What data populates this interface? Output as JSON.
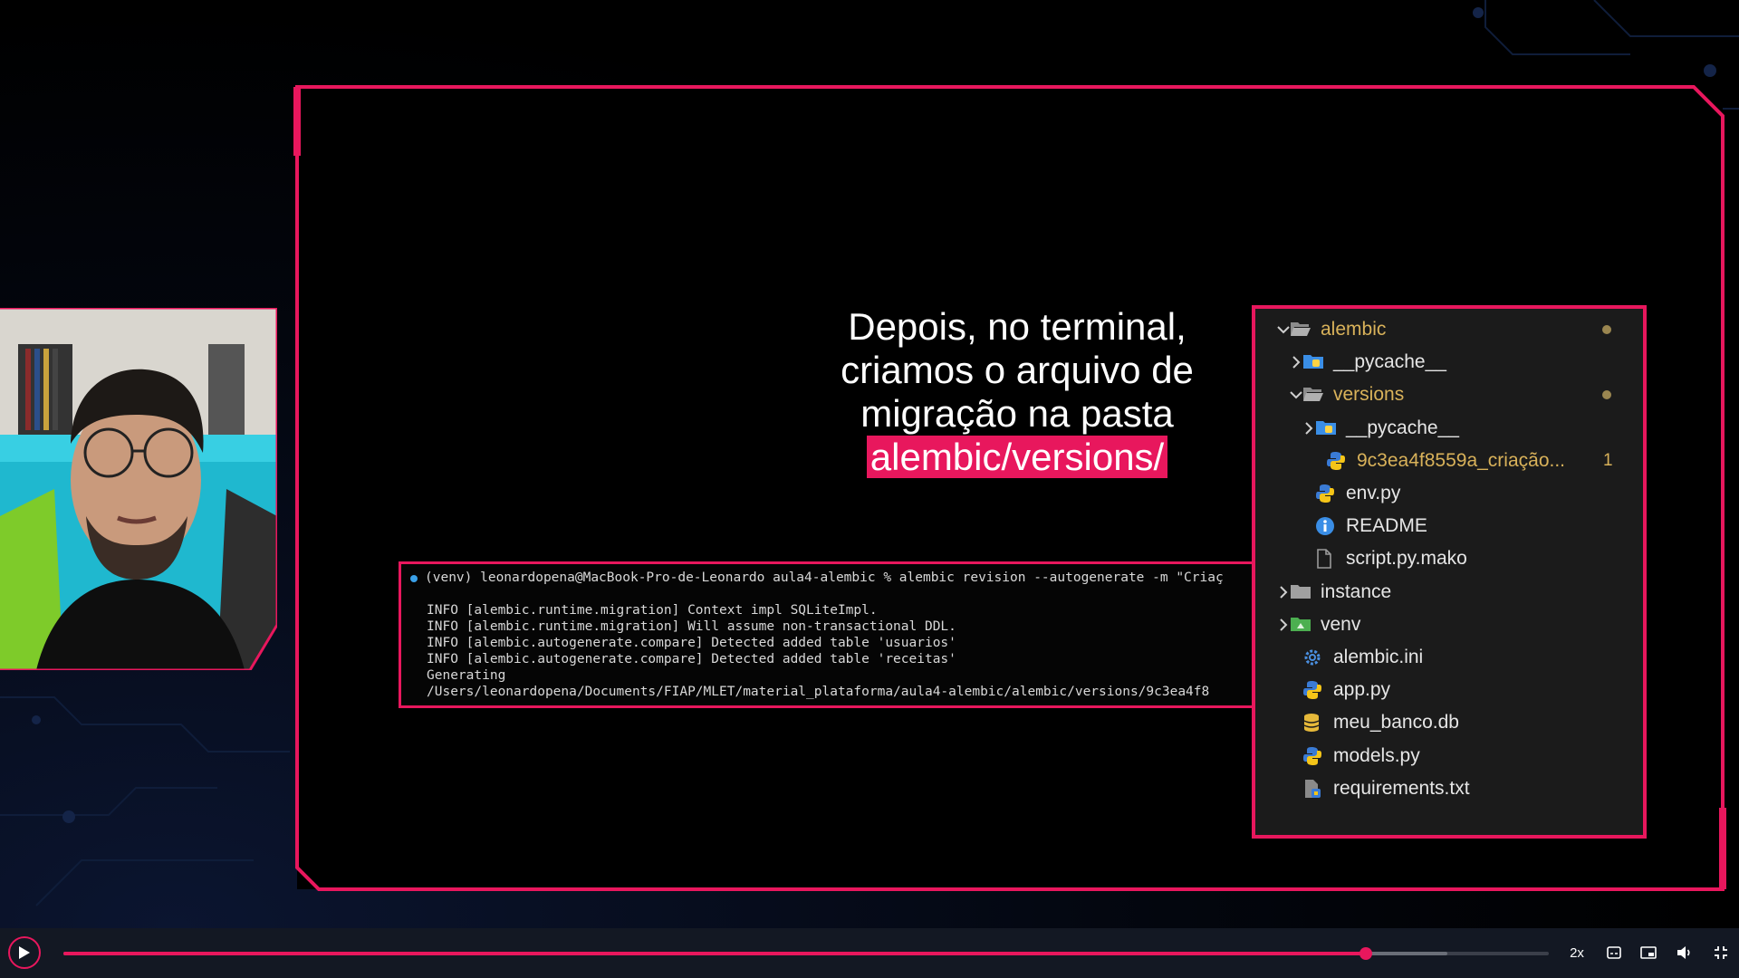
{
  "slide": {
    "headline_lines": [
      "Depois, no terminal,",
      "criamos o arquivo de",
      "migração na pasta"
    ],
    "headline_highlight": "alembic/versions/"
  },
  "terminal": {
    "lines": [
      "(venv) leonardopena@MacBook-Pro-de-Leonardo aula4-alembic % alembic revision --autogenerate -m \"Criaç",
      "INFO  [alembic.runtime.migration] Context impl SQLiteImpl.",
      "INFO  [alembic.runtime.migration] Will assume non-transactional DDL.",
      "INFO  [alembic.autogenerate.compare] Detected added table 'usuarios'",
      "INFO  [alembic.autogenerate.compare] Detected added table 'receitas'",
      "  Generating",
      "  /Users/leonardopena/Documents/FIAP/MLET/material_plataforma/aula4-alembic/alembic/versions/9c3ea4f8"
    ]
  },
  "explorer": {
    "items": [
      {
        "label": "alembic",
        "icon": "folder-open-icon",
        "chevron": "down",
        "modified": true
      },
      {
        "label": "__pycache__",
        "icon": "pycache-folder-icon",
        "chevron": "right",
        "modified": false
      },
      {
        "label": "versions",
        "icon": "folder-open-icon",
        "chevron": "down",
        "modified": true
      },
      {
        "label": "__pycache__",
        "icon": "pycache-folder-icon",
        "chevron": "right",
        "modified": false
      },
      {
        "label": "9c3ea4f8559a_criação...",
        "icon": "python-file-icon",
        "chevron": "",
        "modified": true,
        "badge": "1"
      },
      {
        "label": "env.py",
        "icon": "python-file-icon",
        "chevron": "",
        "modified": false
      },
      {
        "label": "README",
        "icon": "info-icon",
        "chevron": "",
        "modified": false
      },
      {
        "label": "script.py.mako",
        "icon": "file-icon",
        "chevron": "",
        "modified": false
      },
      {
        "label": "instance",
        "icon": "folder-icon",
        "chevron": "right",
        "modified": false
      },
      {
        "label": "venv",
        "icon": "venv-folder-icon",
        "chevron": "right",
        "modified": false
      },
      {
        "label": "alembic.ini",
        "icon": "gear-icon",
        "chevron": "",
        "modified": false
      },
      {
        "label": "app.py",
        "icon": "python-file-icon",
        "chevron": "",
        "modified": false
      },
      {
        "label": "meu_banco.db",
        "icon": "database-icon",
        "chevron": "",
        "modified": false
      },
      {
        "label": "models.py",
        "icon": "python-file-icon",
        "chevron": "",
        "modified": false
      },
      {
        "label": "requirements.txt",
        "icon": "requirements-file-icon",
        "chevron": "",
        "modified": false
      }
    ]
  },
  "player": {
    "progress": 0.877,
    "buffered": 0.932,
    "speed_label": "2x"
  },
  "colors": {
    "accent": "#e8175d",
    "modified_text": "#d9b25a",
    "explorer_bg": "#1b1b1b"
  }
}
